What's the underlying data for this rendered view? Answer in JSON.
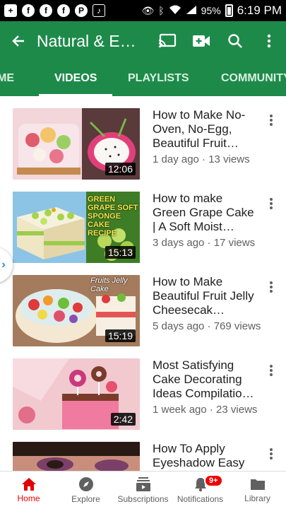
{
  "status_bar": {
    "battery": "95%",
    "time": "6:19 PM"
  },
  "app_bar": {
    "title": "Natural & Easy Cooking"
  },
  "tabs": [
    {
      "label": "HOME"
    },
    {
      "label": "VIDEOS"
    },
    {
      "label": "PLAYLISTS"
    },
    {
      "label": "COMMUNITY"
    }
  ],
  "videos": [
    {
      "title": "How to Make No-Oven, No-Egg, Beautiful Fruit…",
      "meta": "1 day ago · 13 views",
      "duration": "12:06",
      "thumb_text": ""
    },
    {
      "title": "How to make Green Grape Cake | A Soft Moist…",
      "meta": "3 days ago · 17 views",
      "duration": "15:13",
      "thumb_text": "GREEN GRAPE SOFT SPONGE CAKE RECIPE"
    },
    {
      "title": "How to Make Beautiful Fruit Jelly Cheesecak…",
      "meta": "5 days ago · 769 views",
      "duration": "15:19",
      "thumb_text": "Fruits Jelly Cake"
    },
    {
      "title": "Most Satisfying Cake Decorating Ideas Compilatio…",
      "meta": "1 week ago · 23 views",
      "duration": "2:42",
      "thumb_text": ""
    },
    {
      "title": "How To Apply Eyeshadow Easy",
      "meta": "",
      "duration": "",
      "thumb_text": ""
    }
  ],
  "bottom_nav": [
    {
      "label": "Home"
    },
    {
      "label": "Explore"
    },
    {
      "label": "Subscriptions"
    },
    {
      "label": "Notifications"
    },
    {
      "label": "Library"
    }
  ],
  "notifications_badge": "9+",
  "colors": {
    "app_bar": "#1e8a4a",
    "active_nav": "#e00000"
  }
}
